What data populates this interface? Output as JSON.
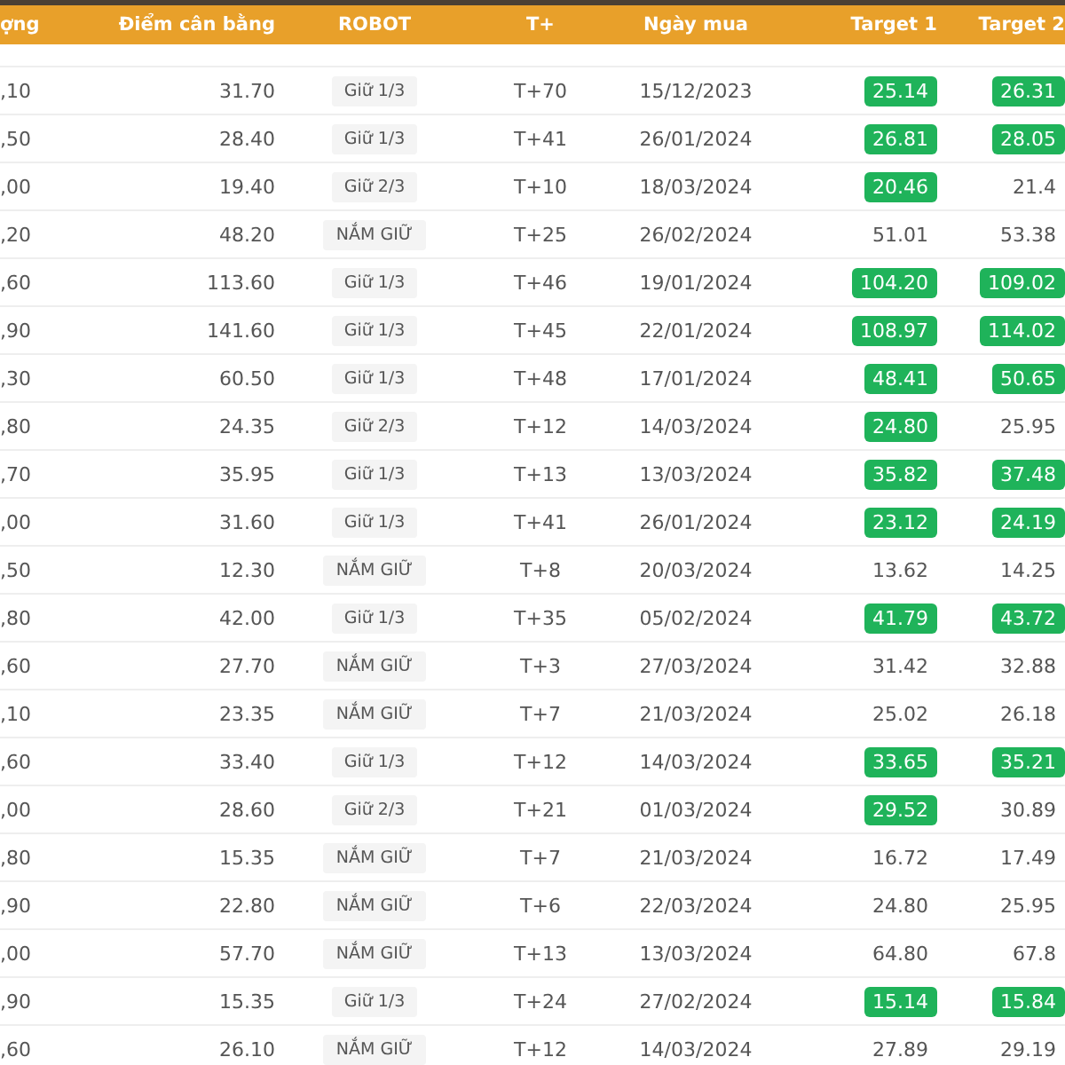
{
  "table": {
    "columns": [
      "ợng",
      "Điểm cân bằng",
      "ROBOT",
      "T+",
      "Ngày mua",
      "Target 1",
      "Target 2"
    ],
    "rows": [
      {
        "volume": ",10",
        "balance": "31.70",
        "robot": "Giữ 1/3",
        "t": "T+70",
        "date": "15/12/2023",
        "target_1": {
          "value": "25.14",
          "hit": true
        },
        "target_2": {
          "value": "26.31",
          "hit": true
        }
      },
      {
        "volume": ",50",
        "balance": "28.40",
        "robot": "Giữ 1/3",
        "t": "T+41",
        "date": "26/01/2024",
        "target_1": {
          "value": "26.81",
          "hit": true
        },
        "target_2": {
          "value": "28.05",
          "hit": true
        }
      },
      {
        "volume": ",00",
        "balance": "19.40",
        "robot": "Giữ 2/3",
        "t": "T+10",
        "date": "18/03/2024",
        "target_1": {
          "value": "20.46",
          "hit": true
        },
        "target_2": {
          "value": "21.4",
          "hit": false
        }
      },
      {
        "volume": ",20",
        "balance": "48.20",
        "robot": "NẮM GIỮ",
        "t": "T+25",
        "date": "26/02/2024",
        "target_1": {
          "value": "51.01",
          "hit": false
        },
        "target_2": {
          "value": "53.38",
          "hit": false
        }
      },
      {
        "volume": ",60",
        "balance": "113.60",
        "robot": "Giữ 1/3",
        "t": "T+46",
        "date": "19/01/2024",
        "target_1": {
          "value": "104.20",
          "hit": true
        },
        "target_2": {
          "value": "109.02",
          "hit": true
        }
      },
      {
        "volume": ",90",
        "balance": "141.60",
        "robot": "Giữ 1/3",
        "t": "T+45",
        "date": "22/01/2024",
        "target_1": {
          "value": "108.97",
          "hit": true
        },
        "target_2": {
          "value": "114.02",
          "hit": true
        }
      },
      {
        "volume": ",30",
        "balance": "60.50",
        "robot": "Giữ 1/3",
        "t": "T+48",
        "date": "17/01/2024",
        "target_1": {
          "value": "48.41",
          "hit": true
        },
        "target_2": {
          "value": "50.65",
          "hit": true
        }
      },
      {
        "volume": ",80",
        "balance": "24.35",
        "robot": "Giữ 2/3",
        "t": "T+12",
        "date": "14/03/2024",
        "target_1": {
          "value": "24.80",
          "hit": true
        },
        "target_2": {
          "value": "25.95",
          "hit": false
        }
      },
      {
        "volume": ",70",
        "balance": "35.95",
        "robot": "Giữ 1/3",
        "t": "T+13",
        "date": "13/03/2024",
        "target_1": {
          "value": "35.82",
          "hit": true
        },
        "target_2": {
          "value": "37.48",
          "hit": true
        }
      },
      {
        "volume": ",00",
        "balance": "31.60",
        "robot": "Giữ 1/3",
        "t": "T+41",
        "date": "26/01/2024",
        "target_1": {
          "value": "23.12",
          "hit": true
        },
        "target_2": {
          "value": "24.19",
          "hit": true
        }
      },
      {
        "volume": ",50",
        "balance": "12.30",
        "robot": "NẮM GIỮ",
        "t": "T+8",
        "date": "20/03/2024",
        "target_1": {
          "value": "13.62",
          "hit": false
        },
        "target_2": {
          "value": "14.25",
          "hit": false
        }
      },
      {
        "volume": ",80",
        "balance": "42.00",
        "robot": "Giữ 1/3",
        "t": "T+35",
        "date": "05/02/2024",
        "target_1": {
          "value": "41.79",
          "hit": true
        },
        "target_2": {
          "value": "43.72",
          "hit": true
        }
      },
      {
        "volume": ",60",
        "balance": "27.70",
        "robot": "NẮM GIỮ",
        "t": "T+3",
        "date": "27/03/2024",
        "target_1": {
          "value": "31.42",
          "hit": false
        },
        "target_2": {
          "value": "32.88",
          "hit": false
        }
      },
      {
        "volume": ",10",
        "balance": "23.35",
        "robot": "NẮM GIỮ",
        "t": "T+7",
        "date": "21/03/2024",
        "target_1": {
          "value": "25.02",
          "hit": false
        },
        "target_2": {
          "value": "26.18",
          "hit": false
        }
      },
      {
        "volume": ",60",
        "balance": "33.40",
        "robot": "Giữ 1/3",
        "t": "T+12",
        "date": "14/03/2024",
        "target_1": {
          "value": "33.65",
          "hit": true
        },
        "target_2": {
          "value": "35.21",
          "hit": true
        }
      },
      {
        "volume": ",00",
        "balance": "28.60",
        "robot": "Giữ 2/3",
        "t": "T+21",
        "date": "01/03/2024",
        "target_1": {
          "value": "29.52",
          "hit": true
        },
        "target_2": {
          "value": "30.89",
          "hit": false
        }
      },
      {
        "volume": ",80",
        "balance": "15.35",
        "robot": "NẮM GIỮ",
        "t": "T+7",
        "date": "21/03/2024",
        "target_1": {
          "value": "16.72",
          "hit": false
        },
        "target_2": {
          "value": "17.49",
          "hit": false
        }
      },
      {
        "volume": ",90",
        "balance": "22.80",
        "robot": "NẮM GIỮ",
        "t": "T+6",
        "date": "22/03/2024",
        "target_1": {
          "value": "24.80",
          "hit": false
        },
        "target_2": {
          "value": "25.95",
          "hit": false
        }
      },
      {
        "volume": ",00",
        "balance": "57.70",
        "robot": "NẮM GIỮ",
        "t": "T+13",
        "date": "13/03/2024",
        "target_1": {
          "value": "64.80",
          "hit": false
        },
        "target_2": {
          "value": "67.8",
          "hit": false
        }
      },
      {
        "volume": ",90",
        "balance": "15.35",
        "robot": "Giữ 1/3",
        "t": "T+24",
        "date": "27/02/2024",
        "target_1": {
          "value": "15.14",
          "hit": true
        },
        "target_2": {
          "value": "15.84",
          "hit": true
        }
      },
      {
        "volume": ",60",
        "balance": "26.10",
        "robot": "NẮM GIỮ",
        "t": "T+12",
        "date": "14/03/2024",
        "target_1": {
          "value": "27.89",
          "hit": false
        },
        "target_2": {
          "value": "29.19",
          "hit": false
        }
      }
    ]
  }
}
